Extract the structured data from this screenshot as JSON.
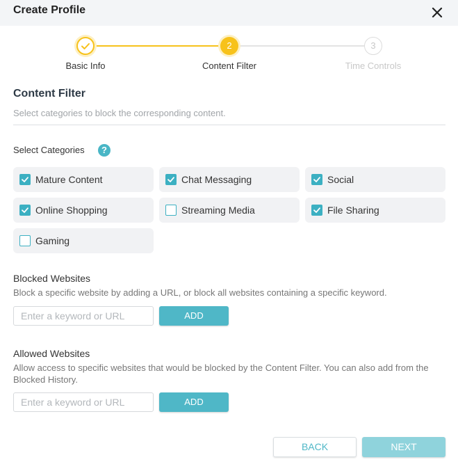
{
  "dialog": {
    "title": "Create Profile"
  },
  "stepper": {
    "steps": [
      {
        "label": "Basic Info",
        "number": "1",
        "state": "done"
      },
      {
        "label": "Content Filter",
        "number": "2",
        "state": "active"
      },
      {
        "label": "Time Controls",
        "number": "3",
        "state": "todo"
      }
    ]
  },
  "content_filter": {
    "title": "Content Filter",
    "description": "Select categories to block the corresponding content.",
    "categories_label": "Select Categories",
    "help_glyph": "?",
    "categories": [
      {
        "label": "Mature Content",
        "checked": true
      },
      {
        "label": "Chat Messaging",
        "checked": true
      },
      {
        "label": "Social",
        "checked": true
      },
      {
        "label": "Online Shopping",
        "checked": true
      },
      {
        "label": "Streaming Media",
        "checked": false
      },
      {
        "label": "File Sharing",
        "checked": true
      },
      {
        "label": "Gaming",
        "checked": false
      }
    ]
  },
  "blocked": {
    "title": "Blocked Websites",
    "description": "Block a specific website by adding a URL, or block all websites containing a specific keyword.",
    "placeholder": "Enter a keyword or URL",
    "add_label": "ADD"
  },
  "allowed": {
    "title": "Allowed Websites",
    "description": "Allow access to specific websites that would be blocked by the Content Filter. You can also add from the Blocked History.",
    "placeholder": "Enter a keyword or URL",
    "add_label": "ADD"
  },
  "footer": {
    "back_label": "BACK",
    "next_label": "NEXT"
  },
  "colors": {
    "accent": "#4fb7c7",
    "step_yellow": "#f7c21b",
    "step_done_text": "#333333",
    "step_todo_text": "#c8c8c8"
  },
  "icons": {
    "close": "close-icon",
    "check": "checkmark-icon",
    "help": "help-icon"
  }
}
